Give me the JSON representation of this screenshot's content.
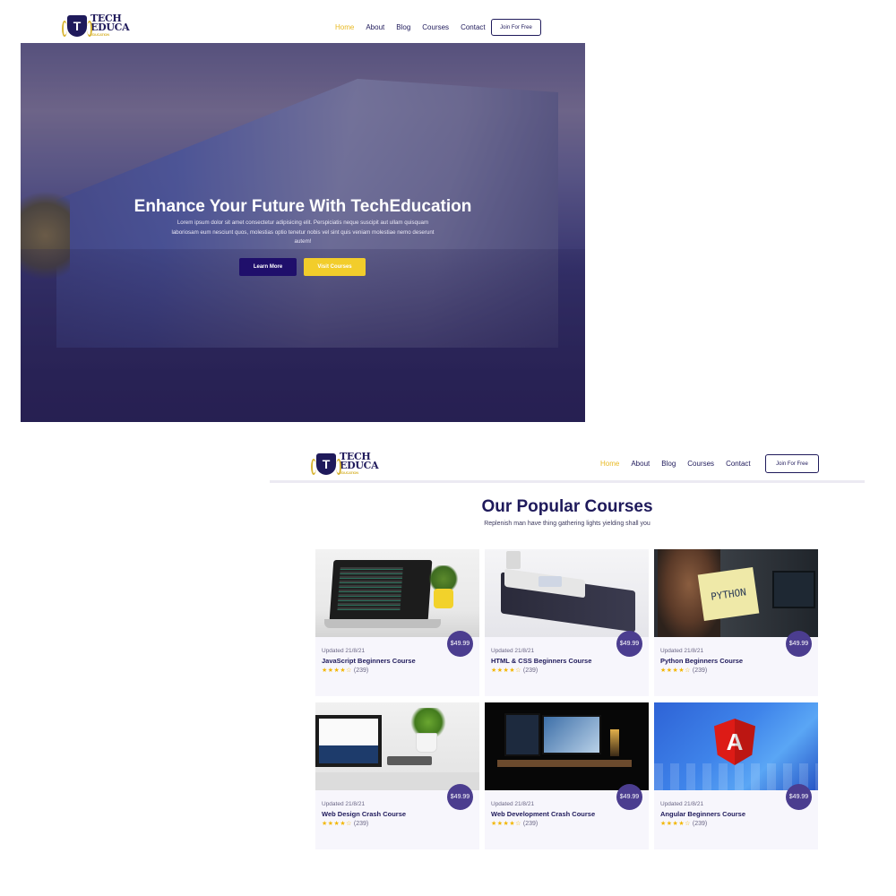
{
  "screen1": {
    "logo": {
      "line1": "TECH",
      "line2": "EDUCA",
      "tagline": "EDUCATION",
      "mark": "T"
    },
    "menu": [
      "Home",
      "About",
      "Blog",
      "Courses",
      "Contact"
    ],
    "join_label": "Join For Free",
    "hero": {
      "title": "Enhance Your Future With TechEducation",
      "text": "Lorem ipsum dolor sit amet consectetur adipisicing elit. Perspiciatis neque suscipit aut ullam quisquam laboriosam eum nesciunt quos, molestias optio tenetur nobis vel sint quis veniam molestiae nemo deserunt autem!",
      "learn_label": "Learn More",
      "visit_label": "Visit Courses"
    }
  },
  "screen2": {
    "logo": {
      "line1": "TECH",
      "line2": "EDUCA",
      "tagline": "EDUCATION",
      "mark": "T"
    },
    "menu": [
      "Home",
      "About",
      "Blog",
      "Courses",
      "Contact"
    ],
    "join_label": "Join For Free",
    "section_title": "Our Popular Courses",
    "section_subtitle": "Replenish man have thing gathering lights yielding shall you",
    "courses": [
      {
        "price": "$49.99",
        "updated": "Updated 21/8/21",
        "name": "JavaScript Beginners Course",
        "stars": "★★★★☆",
        "count": "(239)",
        "thumb": "laptop-code"
      },
      {
        "price": "$49.99",
        "updated": "Updated 21/8/21",
        "name": "HTML & CSS Beginners Course",
        "stars": "★★★★☆",
        "count": "(239)",
        "thumb": "books"
      },
      {
        "price": "$49.99",
        "updated": "Updated 21/8/21",
        "name": "Python Beginners Course",
        "stars": "★★★★☆",
        "count": "(239)",
        "thumb": "python-note",
        "thumb_text": "PYTHON"
      },
      {
        "price": "$49.99",
        "updated": "Updated 21/8/21",
        "name": "Web Design Crash Course",
        "stars": "★★★★☆",
        "count": "(239)",
        "thumb": "desk-plant"
      },
      {
        "price": "$49.99",
        "updated": "Updated 21/8/21",
        "name": "Web Development Crash Course",
        "stars": "★★★★☆",
        "count": "(239)",
        "thumb": "dark-setup"
      },
      {
        "price": "$49.99",
        "updated": "Updated 21/8/21",
        "name": "Angular Beginners Course",
        "stars": "★★★★☆",
        "count": "(239)",
        "thumb": "angular-logo",
        "thumb_text": "A"
      }
    ]
  },
  "colors": {
    "brand": "#1f1a5b",
    "accent": "#f2cd2b",
    "price": "#4b3d8f"
  }
}
